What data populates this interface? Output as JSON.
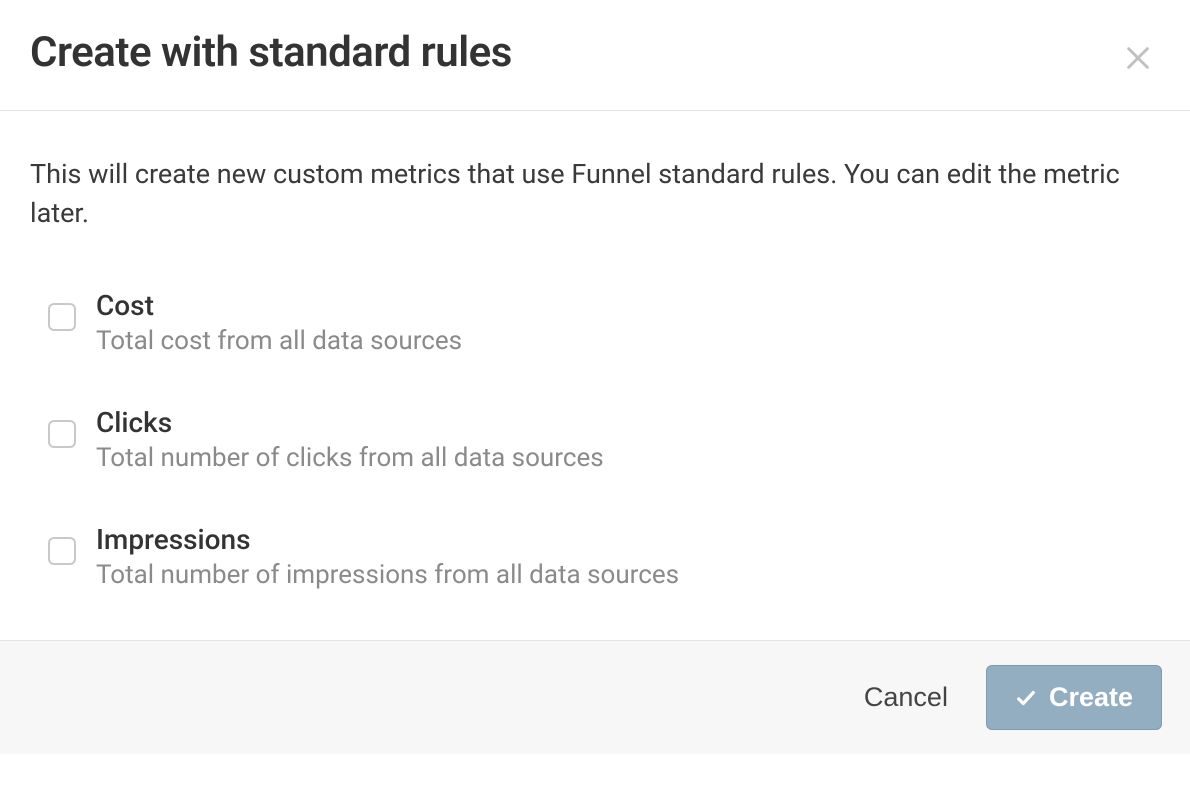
{
  "modal": {
    "title": "Create with standard rules",
    "description": "This will create new custom metrics that use Funnel standard rules. You can edit the metric later.",
    "options": [
      {
        "label": "Cost",
        "description": "Total cost from all data sources"
      },
      {
        "label": "Clicks",
        "description": "Total number of clicks from all data sources"
      },
      {
        "label": "Impressions",
        "description": "Total number of impressions from all data sources"
      }
    ],
    "footer": {
      "cancel": "Cancel",
      "create": "Create"
    }
  }
}
